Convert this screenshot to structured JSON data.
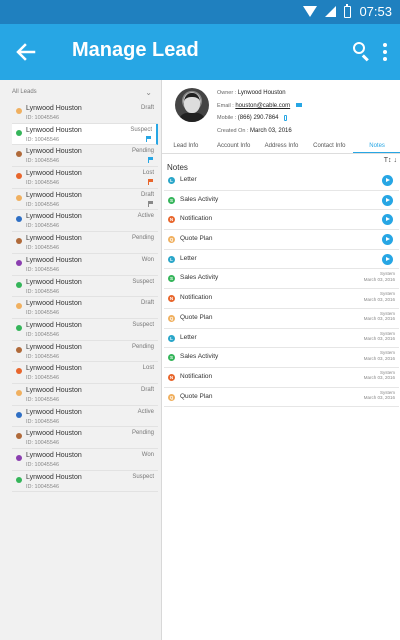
{
  "status_bar": {
    "time": "07:53"
  },
  "app_bar": {
    "title": "Manage Lead"
  },
  "list": {
    "header": "All Leads",
    "items": [
      {
        "name": "Lynwood Houston",
        "id": "ID: 10045546",
        "status": "Draft",
        "dot_color": "#f0b060",
        "flag": false,
        "selected": false
      },
      {
        "name": "Lynwood Houston",
        "id": "ID: 10045546",
        "status": "Suspect",
        "dot_color": "#35b55a",
        "flag": true,
        "flag_color": "#27a6e4",
        "selected": true
      },
      {
        "name": "Lynwood Houston",
        "id": "ID: 10045546",
        "status": "Pending",
        "dot_color": "#b06a3a",
        "flag": true,
        "flag_color": "#27a6e4",
        "selected": false
      },
      {
        "name": "Lynwood Houston",
        "id": "ID: 10045546",
        "status": "Lost",
        "dot_color": "#e8662c",
        "flag": true,
        "flag_color": "#e8662c",
        "selected": false
      },
      {
        "name": "Lynwood Houston",
        "id": "ID: 10045546",
        "status": "Draft",
        "dot_color": "#f0b060",
        "flag": true,
        "flag_color": "#888888",
        "selected": false
      },
      {
        "name": "Lynwood Houston",
        "id": "ID: 10045546",
        "status": "Active",
        "dot_color": "#2f6fc4",
        "flag": false,
        "selected": false
      },
      {
        "name": "Lynwood Houston",
        "id": "ID: 10045546",
        "status": "Pending",
        "dot_color": "#b06a3a",
        "flag": false,
        "selected": false
      },
      {
        "name": "Lynwood Houston",
        "id": "ID: 10045546",
        "status": "Won",
        "dot_color": "#8b3fb0",
        "flag": false,
        "selected": false
      },
      {
        "name": "Lynwood Houston",
        "id": "ID: 10045546",
        "status": "Suspect",
        "dot_color": "#35b55a",
        "flag": false,
        "selected": false
      },
      {
        "name": "Lynwood Houston",
        "id": "ID: 10045546",
        "status": "Draft",
        "dot_color": "#f0b060",
        "flag": false,
        "selected": false
      },
      {
        "name": "Lynwood Houston",
        "id": "ID: 10045546",
        "status": "Suspect",
        "dot_color": "#35b55a",
        "flag": false,
        "selected": false
      },
      {
        "name": "Lynwood Houston",
        "id": "ID: 10045546",
        "status": "Pending",
        "dot_color": "#b06a3a",
        "flag": false,
        "selected": false
      },
      {
        "name": "Lynwood Houston",
        "id": "ID: 10045546",
        "status": "Lost",
        "dot_color": "#e8662c",
        "flag": false,
        "selected": false
      },
      {
        "name": "Lynwood Houston",
        "id": "ID: 10045546",
        "status": "Draft",
        "dot_color": "#f0b060",
        "flag": false,
        "selected": false
      },
      {
        "name": "Lynwood Houston",
        "id": "ID: 10045546",
        "status": "Active",
        "dot_color": "#2f6fc4",
        "flag": false,
        "selected": false
      },
      {
        "name": "Lynwood Houston",
        "id": "ID: 10045546",
        "status": "Pending",
        "dot_color": "#b06a3a",
        "flag": false,
        "selected": false
      },
      {
        "name": "Lynwood Houston",
        "id": "ID: 10045546",
        "status": "Won",
        "dot_color": "#8b3fb0",
        "flag": false,
        "selected": false
      },
      {
        "name": "Lynwood Houston",
        "id": "ID: 10045546",
        "status": "Suspect",
        "dot_color": "#35b55a",
        "flag": false,
        "selected": false
      }
    ]
  },
  "detail": {
    "owner_label": "Owner :",
    "owner": "Lynwood Houston",
    "email_label": "Email :",
    "email": "houston@cable.com",
    "mobile_label": "Mobile :",
    "mobile": "(866) 290.7864",
    "created_label": "Created On :",
    "created": "March 03, 2016",
    "tabs": [
      "Lead Info",
      "Account Info",
      "Address Info",
      "Contact Info",
      "Notes"
    ],
    "active_tab": 4,
    "notes_title": "Notes",
    "notes": [
      {
        "letter": "L",
        "title": "Letter",
        "color": "#2aa6c9",
        "action": "play"
      },
      {
        "letter": "S",
        "title": "Sales Activity",
        "color": "#35b55a",
        "action": "play"
      },
      {
        "letter": "N",
        "title": "Notification",
        "color": "#e8662c",
        "action": "play"
      },
      {
        "letter": "Q",
        "title": "Quote Plan",
        "color": "#f0b060",
        "action": "play"
      },
      {
        "letter": "L",
        "title": "Letter",
        "color": "#2aa6c9",
        "action": "play"
      },
      {
        "letter": "S",
        "title": "Sales Activity",
        "color": "#35b55a",
        "action": "meta",
        "meta_by": "System",
        "meta_date": "March 03, 2016"
      },
      {
        "letter": "N",
        "title": "Notification",
        "color": "#e8662c",
        "action": "meta",
        "meta_by": "System",
        "meta_date": "March 03, 2016"
      },
      {
        "letter": "Q",
        "title": "Quote Plan",
        "color": "#f0b060",
        "action": "meta",
        "meta_by": "System",
        "meta_date": "March 03, 2016"
      },
      {
        "letter": "L",
        "title": "Letter",
        "color": "#2aa6c9",
        "action": "meta",
        "meta_by": "System",
        "meta_date": "March 03, 2016"
      },
      {
        "letter": "S",
        "title": "Sales Activity",
        "color": "#35b55a",
        "action": "meta",
        "meta_by": "System",
        "meta_date": "March 03, 2016"
      },
      {
        "letter": "N",
        "title": "Notification",
        "color": "#e8662c",
        "action": "meta",
        "meta_by": "System",
        "meta_date": "March 03, 2016"
      },
      {
        "letter": "Q",
        "title": "Quote Plan",
        "color": "#f0b060",
        "action": "meta",
        "meta_by": "System",
        "meta_date": "March 03, 2016"
      }
    ]
  },
  "colors": {
    "status_bar": "#1f80bf",
    "app_bar": "#27a6e4",
    "accent": "#27a6e4"
  }
}
